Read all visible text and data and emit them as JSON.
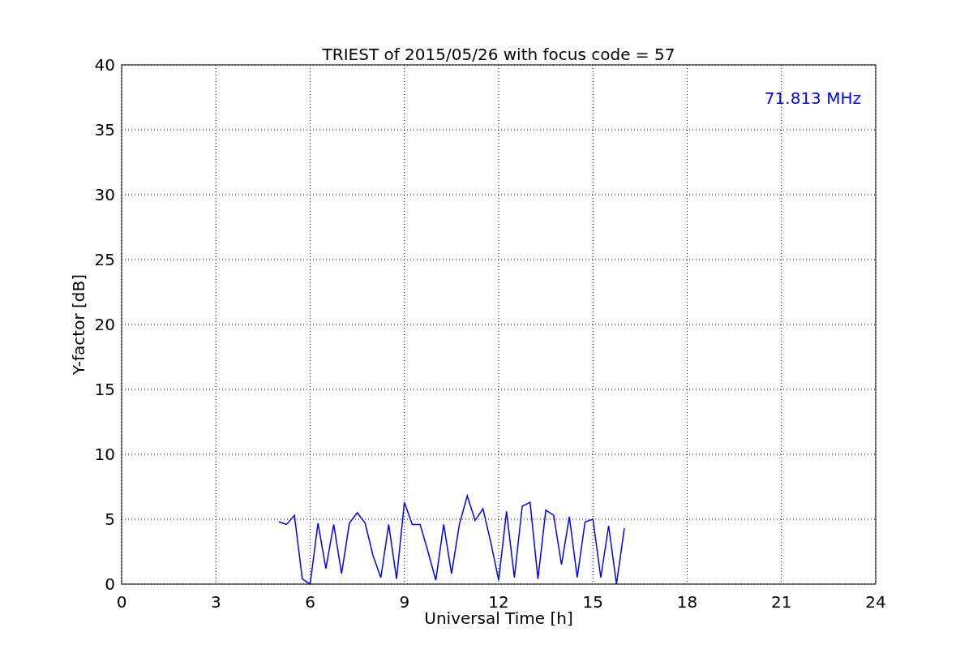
{
  "figure": {
    "chart_data": {
      "type": "line",
      "title": "TRIEST of 2015/05/26 with focus code = 57",
      "xlabel": "Universal Time [h]",
      "ylabel": "Y-factor [dB]",
      "x": [
        5,
        5.25,
        5.5,
        5.75,
        6,
        6.25,
        6.5,
        6.75,
        7,
        7.25,
        7.5,
        7.75,
        8,
        8.25,
        8.5,
        8.75,
        9,
        9.25,
        9.5,
        9.75,
        10,
        10.25,
        10.5,
        10.75,
        11,
        11.25,
        11.5,
        11.75,
        12,
        12.25,
        12.5,
        12.75,
        13,
        13.25,
        13.5,
        13.75,
        14,
        14.25,
        14.5,
        14.75,
        15,
        15.25,
        15.5,
        15.75,
        16
      ],
      "series": [
        {
          "name": "71.813 MHz",
          "color": "#0000ff",
          "values": [
            4.8,
            4.6,
            5.3,
            0.4,
            0.0,
            4.7,
            1.2,
            4.6,
            0.8,
            4.7,
            5.5,
            4.7,
            2.2,
            0.5,
            4.6,
            0.4,
            6.3,
            4.6,
            4.6,
            2.5,
            0.3,
            4.6,
            0.8,
            4.6,
            6.8,
            4.9,
            5.8,
            3.2,
            0.3,
            5.6,
            0.5,
            6.0,
            6.3,
            0.4,
            5.7,
            5.3,
            1.5,
            5.2,
            0.5,
            4.8,
            5.0,
            0.5,
            4.5,
            0.0,
            4.3
          ]
        }
      ],
      "grid": true,
      "xlim": [
        0,
        24
      ],
      "ylim": [
        0,
        40
      ],
      "xticks": [
        0,
        3,
        6,
        9,
        12,
        15,
        18,
        21,
        24
      ],
      "yticks": [
        0,
        5,
        10,
        15,
        20,
        25,
        30,
        35,
        40
      ]
    }
  }
}
